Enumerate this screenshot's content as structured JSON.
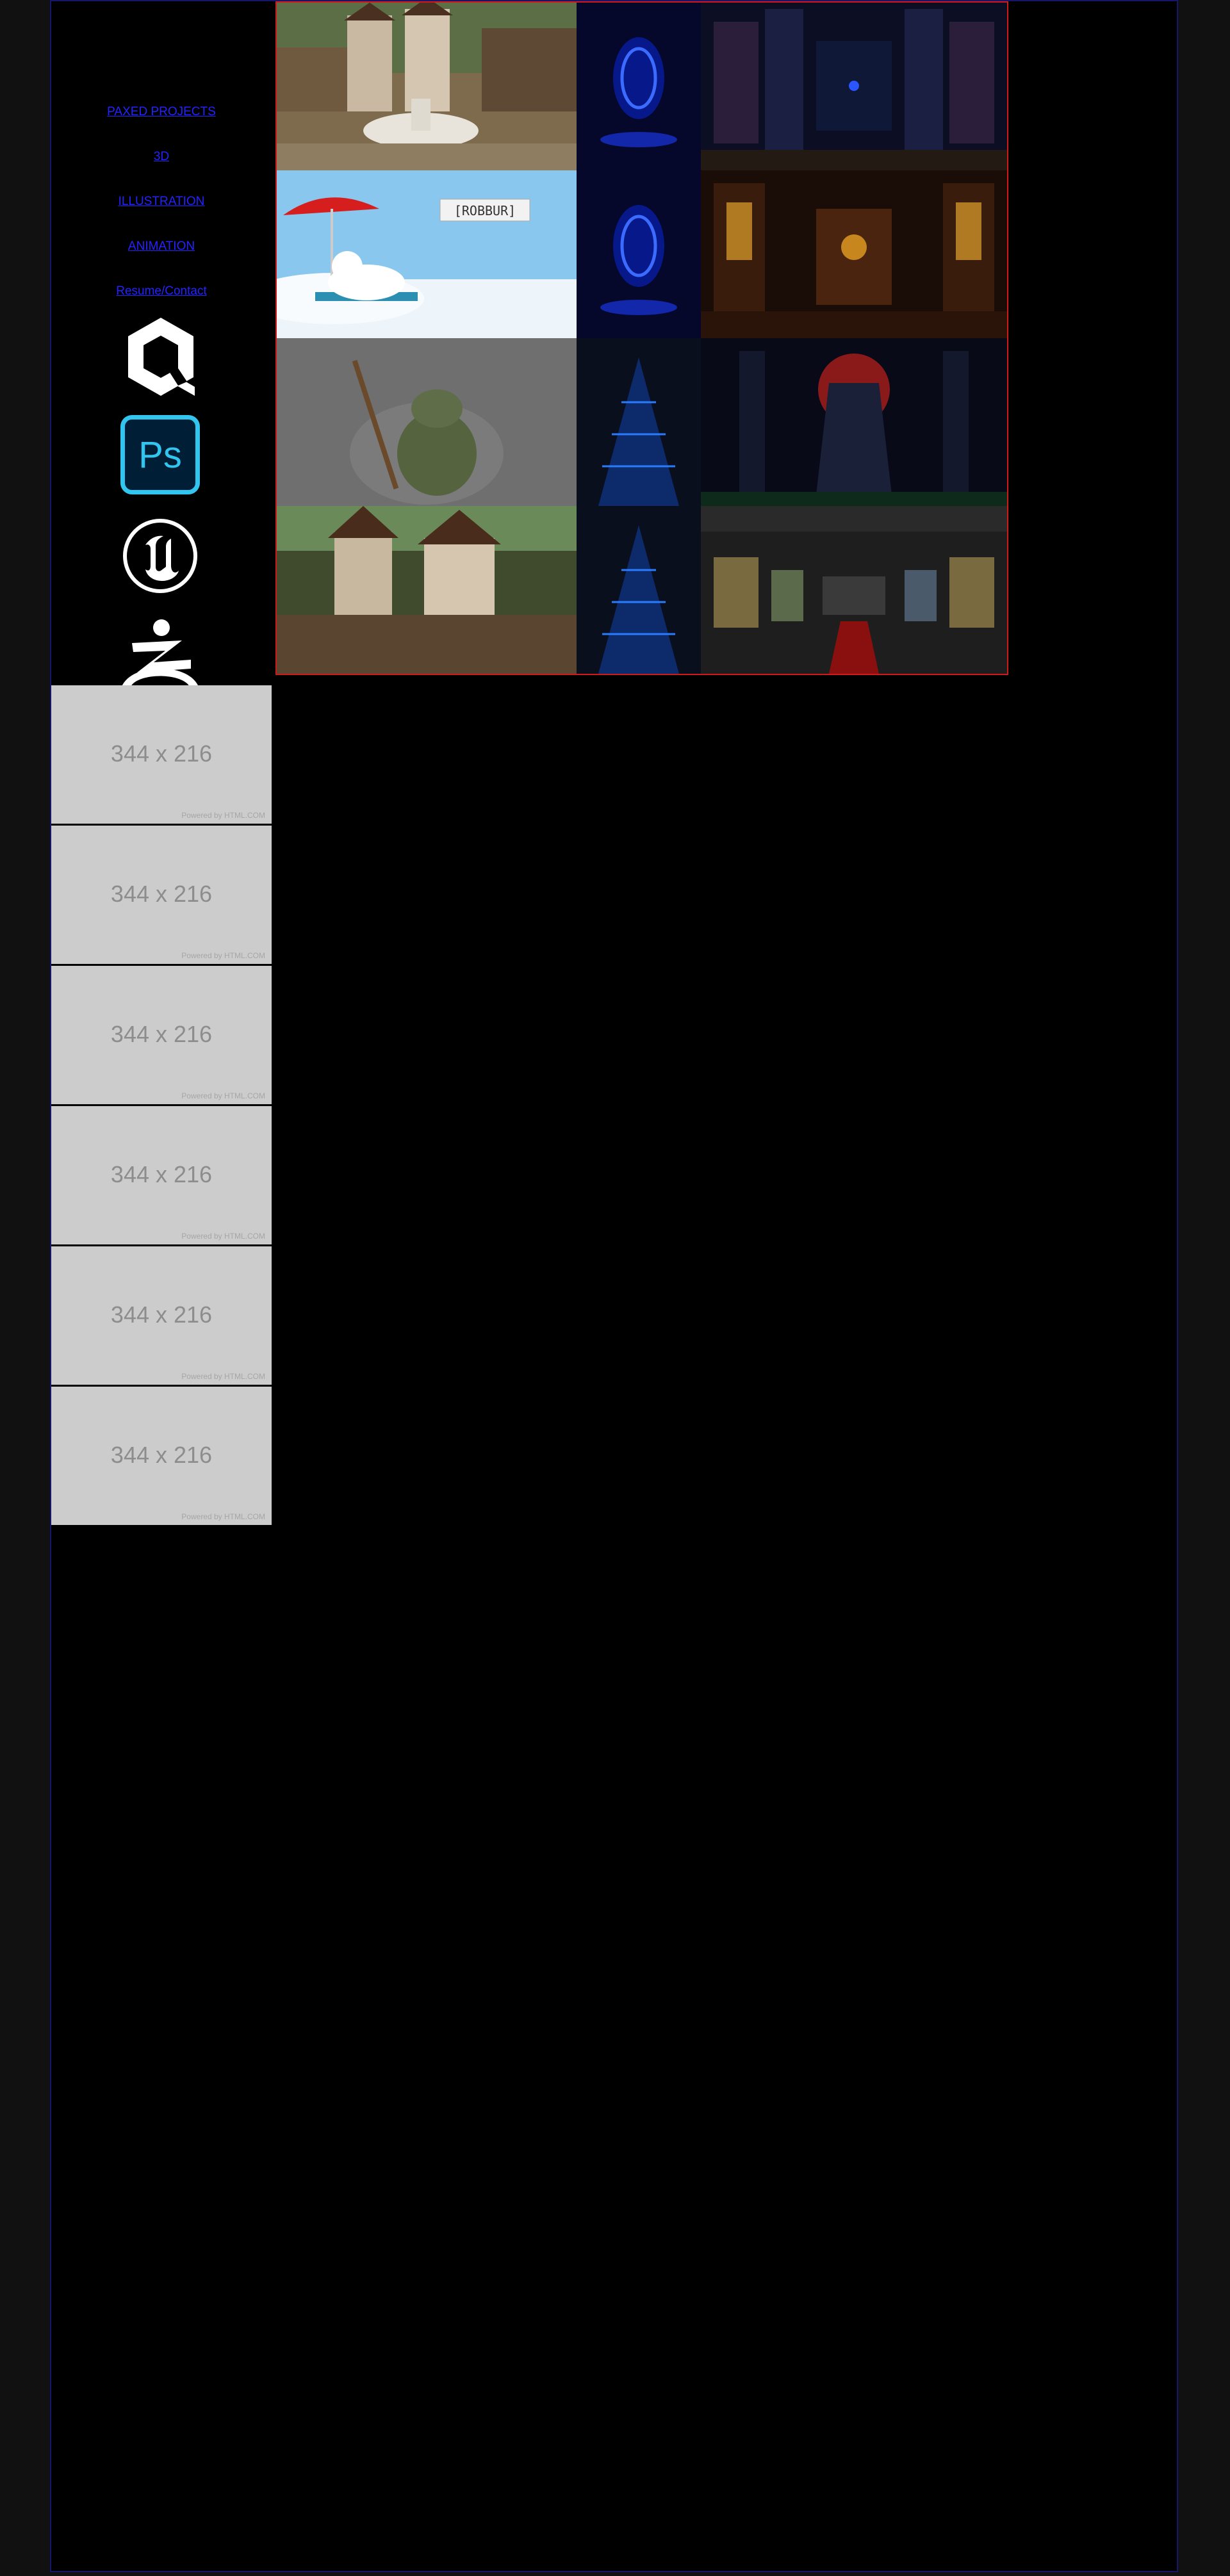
{
  "nav": {
    "items": [
      {
        "label": "PAXED PROJECTS"
      },
      {
        "label": "3D"
      },
      {
        "label": "ILLUSTRATION"
      },
      {
        "label": "ANIMATION"
      },
      {
        "label": "Resume/Contact"
      }
    ]
  },
  "tools": [
    {
      "icon": "quixel-icon"
    },
    {
      "icon": "photoshop-icon",
      "text": "Ps"
    },
    {
      "icon": "unreal-engine-icon"
    },
    {
      "icon": "zbrush-icon"
    }
  ],
  "placeholders": [
    {
      "size": "344 x 216",
      "credit": "Powered by HTML.COM"
    },
    {
      "size": "344 x 216",
      "credit": "Powered by HTML.COM"
    },
    {
      "size": "344 x 216",
      "credit": "Powered by HTML.COM"
    },
    {
      "size": "344 x 216",
      "credit": "Powered by HTML.COM"
    },
    {
      "size": "344 x 216",
      "credit": "Powered by HTML.COM"
    },
    {
      "size": "344 x 216",
      "credit": "Powered by HTML.COM"
    }
  ],
  "gallery": {
    "banner_text": "[ROBBUR]",
    "colors": {
      "frame": "#d01a1a",
      "link": "#2323ff",
      "page_border": "#15156b"
    }
  }
}
